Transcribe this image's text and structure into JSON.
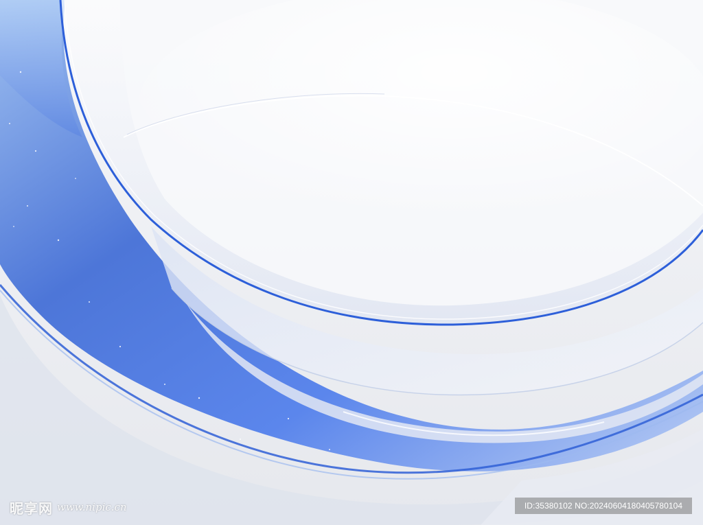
{
  "watermark": {
    "brand": "昵享网",
    "site": "www.nipic.cn",
    "id_text": "ID:35380102 NO:20240604180405780104"
  },
  "palette": {
    "background": "#eef0f4",
    "ribbon_blue": "#3f6fe0",
    "ribbon_light": "#a9c3f2",
    "glass_edge": "#2f5fd6"
  }
}
